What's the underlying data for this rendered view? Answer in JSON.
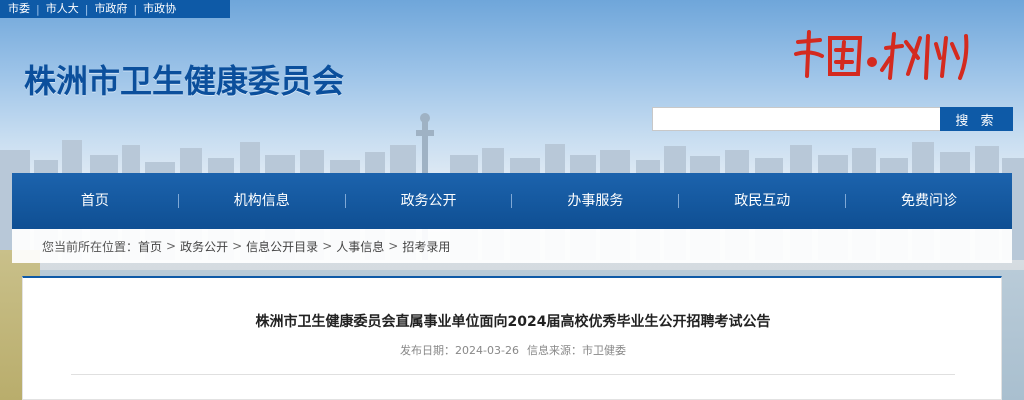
{
  "topbar": {
    "links": [
      "市委",
      "市人大",
      "市政府",
      "市政协"
    ]
  },
  "header": {
    "site_title": "株洲市卫生健康委员会",
    "brand_mark": "中国·株洲"
  },
  "search": {
    "value": "",
    "placeholder": "",
    "button_label": "搜 索"
  },
  "nav": {
    "items": [
      "首页",
      "机构信息",
      "政务公开",
      "办事服务",
      "政民互动",
      "免费问诊"
    ]
  },
  "breadcrumb": {
    "prefix": "您当前所在位置：",
    "items": [
      "首页",
      "政务公开",
      "信息公开目录",
      "人事信息",
      "招考录用"
    ],
    "separator": ">"
  },
  "article": {
    "title": "株洲市卫生健康委员会直属事业单位面向2024届高校优秀毕业生公开招聘考试公告",
    "publish_label": "发布日期：",
    "publish_date": "2024-03-26",
    "source_label": "信息来源：",
    "source": "市卫健委"
  },
  "colors": {
    "brand_blue": "#0e5aa7",
    "title_blue": "#0b4f9c",
    "seal_red": "#d42a1f"
  }
}
